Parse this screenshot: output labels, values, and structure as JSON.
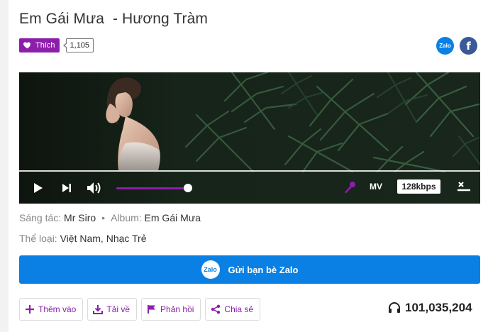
{
  "song": {
    "title": "Em Gái Mưa  - Hương Tràm"
  },
  "like": {
    "label": "Thích",
    "count": "1,105"
  },
  "share_top": {
    "zalo_label": "Zalo",
    "facebook_label": "f"
  },
  "player": {
    "mv_label": "MV",
    "quality": "128kbps",
    "volume_level": 1.0,
    "progress": 0.0
  },
  "meta": {
    "composer_label": "Sáng tác:",
    "composer": "Mr Siro",
    "album_label": "Album:",
    "album": "Em Gái Mưa",
    "genre_label": "Thể loại:",
    "genres": [
      "Việt Nam",
      "Nhạc Trẻ"
    ]
  },
  "zalo_send": {
    "icon_label": "Zalo",
    "label": "Gửi bạn bè Zalo"
  },
  "actions": {
    "add": "Thêm vào",
    "download": "Tải về",
    "feedback": "Phản hồi",
    "share": "Chia sẻ"
  },
  "listens": "101,035,204",
  "colors": {
    "brand_purple": "#8d1eaa",
    "zalo_blue": "#0a80e4",
    "facebook_blue": "#3b5998"
  },
  "icons": [
    "heart-icon",
    "play-icon",
    "next-icon",
    "volume-icon",
    "karaoke-mic-icon",
    "fullscreen-exit-icon",
    "plus-icon",
    "download-icon",
    "flag-icon",
    "share-icon",
    "headphones-icon"
  ]
}
